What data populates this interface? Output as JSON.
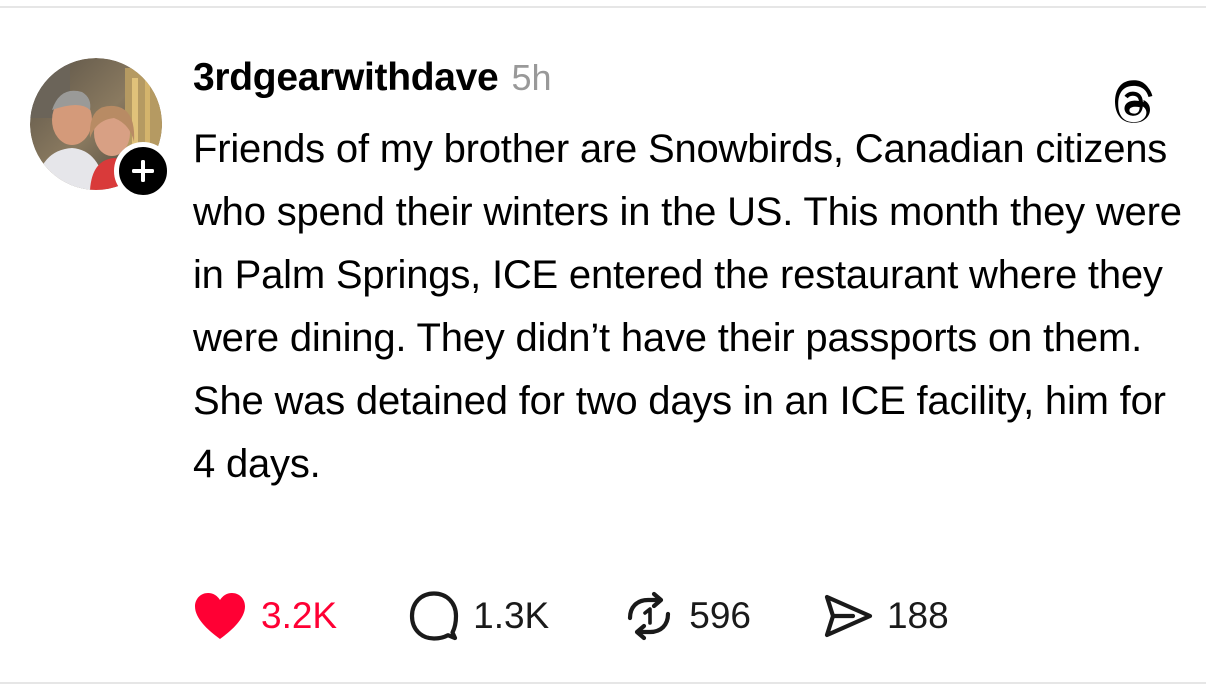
{
  "post": {
    "username": "3rdgearwithdave",
    "timestamp": "5h",
    "text": "Friends of my brother are Snowbirds, Canadian citizens who spend their winters in the US. This month they were in Palm Springs, ICE entered the restaurant where they were dining. They didn’t have their passports on them. She was detained for two days in an ICE facility, him for 4 days.",
    "avatar_icon": "profile-photo",
    "follow_icon": "plus-icon",
    "platform_icon": "threads-logo-icon"
  },
  "actions": {
    "likes": {
      "icon": "heart-icon",
      "count": "3.2K",
      "color": "#ff0034",
      "liked": true
    },
    "replies": {
      "icon": "comment-bubble-icon",
      "count": "1.3K"
    },
    "reposts": {
      "icon": "repost-icon",
      "count": "596"
    },
    "shares": {
      "icon": "send-icon",
      "count": "188"
    }
  }
}
